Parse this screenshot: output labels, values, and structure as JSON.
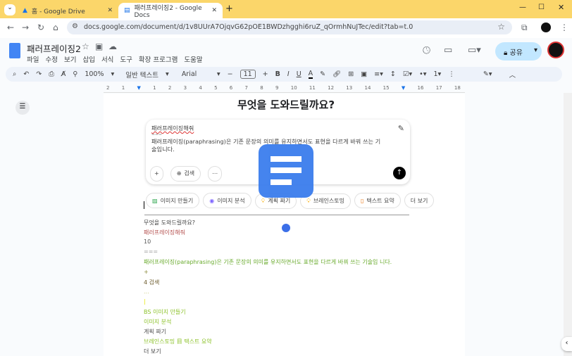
{
  "browser": {
    "tabs": [
      {
        "title": "홈 - Google Drive"
      },
      {
        "title": "패러프레이징2 - Google Docs"
      }
    ],
    "url": "docs.google.com/document/d/1v8UUrA7OjqvG62pOE1BWDzhgghi6ruZ_qOrmhNuJTec/edit?tab=t.0"
  },
  "doc": {
    "title": "패러프레이징2",
    "menu": [
      "파일",
      "수정",
      "보기",
      "삽입",
      "서식",
      "도구",
      "확장 프로그램",
      "도움말"
    ],
    "share_label": "공유"
  },
  "toolbar": {
    "zoom": "100%",
    "style": "일반 텍스트",
    "font": "Arial",
    "font_size": "11"
  },
  "ruler": [
    "2",
    "1",
    "1",
    "2",
    "3",
    "4",
    "5",
    "6",
    "7",
    "8",
    "9",
    "10",
    "11",
    "12",
    "13",
    "14",
    "15",
    "16",
    "17",
    "18",
    "19"
  ],
  "gemini": {
    "heading": "무엇을 도와드릴까요?",
    "prompt_line1": "패러프레이징해줘",
    "prompt_sep": "===",
    "prompt_body": "패러프레이징(paraphrasing)은 기존 문장의 의미를 유지하면서도 표현을 다르게 바꿔 쓰는 기술입니다.",
    "search_label": "검색",
    "chips": [
      "이미지 만들기",
      "이미지 분석",
      "계획 짜기",
      "브레인스토밍",
      "텍스트 요약",
      "더 보기"
    ]
  },
  "body_lines": [
    {
      "text": "무엇을 도와드릴까요?",
      "color": "#444444"
    },
    {
      "text": "패러프레이징해줘",
      "color": "#b5514f"
    },
    {
      "text": "10",
      "color": "#555555"
    },
    {
      "text": "===",
      "color": "#999999"
    },
    {
      "text": "패러프레이징(paraphrasing)은 기존 문장의 의미를 유지하면서도 표현을 다르게 바꿔 쓰는 기술입 니다.",
      "color": "#6aab2e"
    },
    {
      "text": "+",
      "color": "#8a8a3a"
    },
    {
      "text": "4 검색",
      "color": "#6b5a2a"
    },
    {
      "text": "...",
      "color": "#c9c97a"
    },
    {
      "text": "|",
      "color": "#e8e800"
    },
    {
      "text": "BS 이미지 만들기",
      "color": "#8cc22a"
    },
    {
      "text": "이미지 분석",
      "color": "#8cc22a"
    },
    {
      "text": "계획 짜기",
      "color": "#555555"
    },
    {
      "text": "브레인스토밍 目 텍스트 요약",
      "color": "#8cc22a"
    },
    {
      "text": "더 보기",
      "color": "#444444"
    }
  ]
}
